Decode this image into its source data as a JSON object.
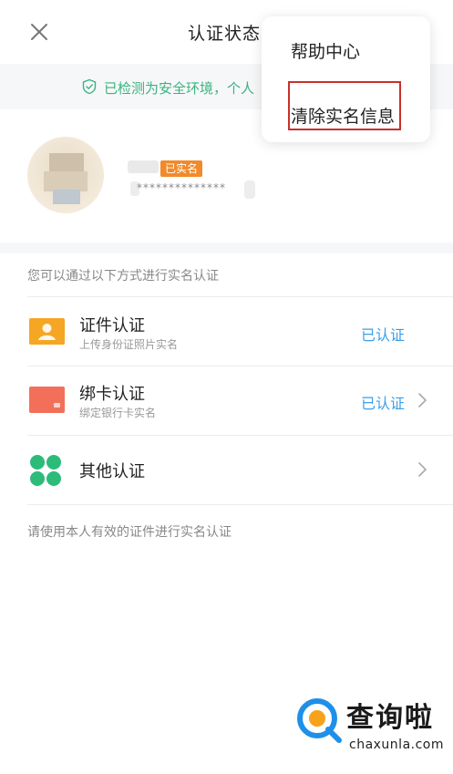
{
  "header": {
    "title": "认证状态"
  },
  "safety_bar": {
    "text": "已检测为安全环境，个人"
  },
  "profile": {
    "badge": "已实名",
    "masked_id": "**************"
  },
  "section_hint": "您可以通过以下方式进行实名认证",
  "methods": [
    {
      "title": "证件认证",
      "subtitle": "上传身份证照片实名",
      "status": "已认证"
    },
    {
      "title": "绑卡认证",
      "subtitle": "绑定银行卡实名",
      "status": "已认证"
    },
    {
      "title": "其他认证",
      "subtitle": "",
      "status": ""
    }
  ],
  "footer_note": "请使用本人有效的证件进行实名认证",
  "menu": {
    "items": [
      {
        "label": "帮助中心"
      },
      {
        "label": "清除实名信息"
      }
    ]
  },
  "watermark": {
    "name": "查询啦",
    "domain": "chaxunla.com"
  },
  "colors": {
    "accent_green": "#3bb37f",
    "status_blue": "#3a9ee8",
    "badge_orange": "#f08a2a",
    "highlight_red": "#c9302c"
  }
}
